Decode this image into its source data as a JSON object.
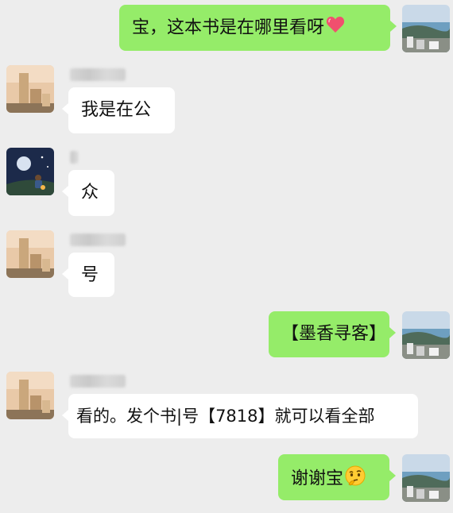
{
  "messages": [
    {
      "side": "out",
      "text": "宝，这本书是在哪里看呀",
      "emoji": "heart-icon"
    },
    {
      "side": "in",
      "text": "我是在公"
    },
    {
      "side": "in",
      "text": "众"
    },
    {
      "side": "in",
      "text": "号"
    },
    {
      "side": "out",
      "text": "【墨香寻客】"
    },
    {
      "side": "in",
      "text": "看的。发个书|号【7818】就可以看全部"
    },
    {
      "side": "out",
      "text": "谢谢宝",
      "emoji": "thinking-face-icon"
    }
  ],
  "colors": {
    "background": "#ededed",
    "incoming": "#ffffff",
    "outgoing": "#95ec69"
  }
}
